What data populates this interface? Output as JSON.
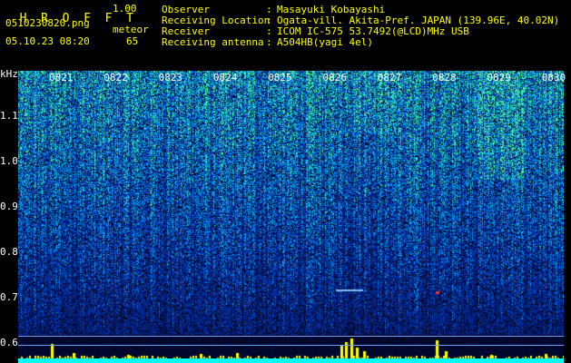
{
  "header": {
    "logo_letters": [
      "H",
      "R",
      "O",
      "F",
      "F",
      "T"
    ],
    "version": "1.00",
    "filename": "0510230820.png",
    "datetime": "05.10.23 08:20",
    "meteor_label": "meteor",
    "meteor_count": "65",
    "info": [
      {
        "label": "Observer",
        "value": "Masayuki Kobayashi"
      },
      {
        "label": "Receiving Location",
        "value": "Ogata-vill. Akita-Pref. JAPAN (139.96E, 40.02N)"
      },
      {
        "label": "Receiver",
        "value": "ICOM IC-575 53.7492(@LCD)MHz USB"
      },
      {
        "label": "Receiving antenna",
        "value": "A504HB(yagi 4el)"
      }
    ]
  },
  "spectrogram": {
    "freq_unit": "kHz",
    "freq_ticks": [
      {
        "value": 1.1,
        "label": "1.1"
      },
      {
        "value": 1.0,
        "label": "1.0"
      },
      {
        "value": 0.9,
        "label": "0.9"
      },
      {
        "value": 0.8,
        "label": "0.8"
      },
      {
        "value": 0.7,
        "label": "0.7"
      },
      {
        "value": 0.6,
        "label": "0.6"
      }
    ],
    "time_ticks": [
      "0821",
      "0822",
      "0823",
      "0824",
      "0825",
      "0826",
      "0827",
      "0828",
      "0829",
      "0830"
    ],
    "colors": {
      "background": "#000000",
      "label_yellow": "#ffff00",
      "label_cyan": "#00ffff",
      "signal_low": "#0a1a6a",
      "signal_high": "#40ffa0",
      "meteor": "#ff3030"
    }
  }
}
